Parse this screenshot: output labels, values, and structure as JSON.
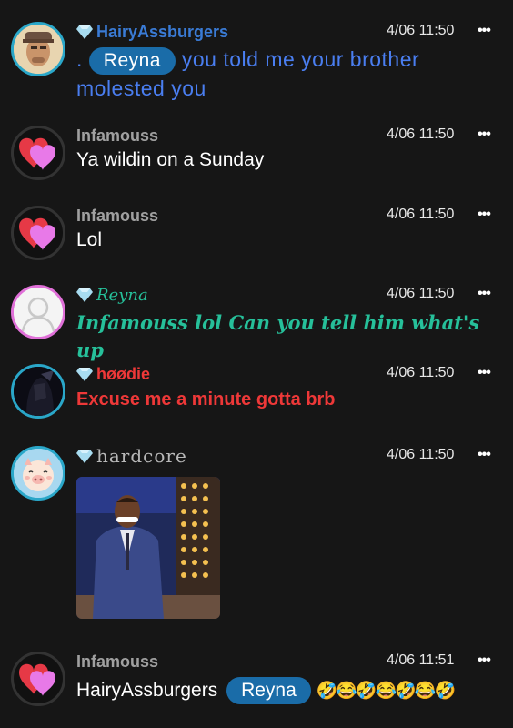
{
  "colors": {
    "background": "#161616",
    "mention_pill": "#1a6ca8",
    "hairy_name": "#3a7bd5",
    "hairy_text": "#4a7ef0",
    "reyna": "#26c09a",
    "hoodie": "#ee3838",
    "hardcore": "#b8b8b8",
    "infamouss": "#a0a0a0"
  },
  "messages": [
    {
      "username": "HairyAssburgers",
      "time": "4/06 11:50",
      "more": "•••",
      "prefix": ".",
      "mention": "Reyna",
      "text_line1": "you told me your brother",
      "text_line2": "molested you"
    },
    {
      "username": "Infamouss",
      "time": "4/06 11:50",
      "more": "•••",
      "text": "Ya wildin on a Sunday"
    },
    {
      "username": "Infamouss",
      "time": "4/06 11:50",
      "more": "•••",
      "text": "Lol"
    },
    {
      "username": "Reyna",
      "time": "4/06 11:50",
      "more": "•••",
      "text": "Infamouss lol Can you tell him what's up"
    },
    {
      "username": "høødie",
      "time": "4/06 11:50",
      "more": "•••",
      "text": "Excuse me a minute gotta brb"
    },
    {
      "username": "hardcore",
      "time": "4/06 11:50",
      "more": "•••",
      "image": "meme-gif"
    },
    {
      "username": "Infamouss",
      "time": "4/06 11:51",
      "more": "•••",
      "text": "HairyAssburgers",
      "mention": "Reyna",
      "emojis": "🤣😂🤣😂🤣😂🤣"
    }
  ]
}
